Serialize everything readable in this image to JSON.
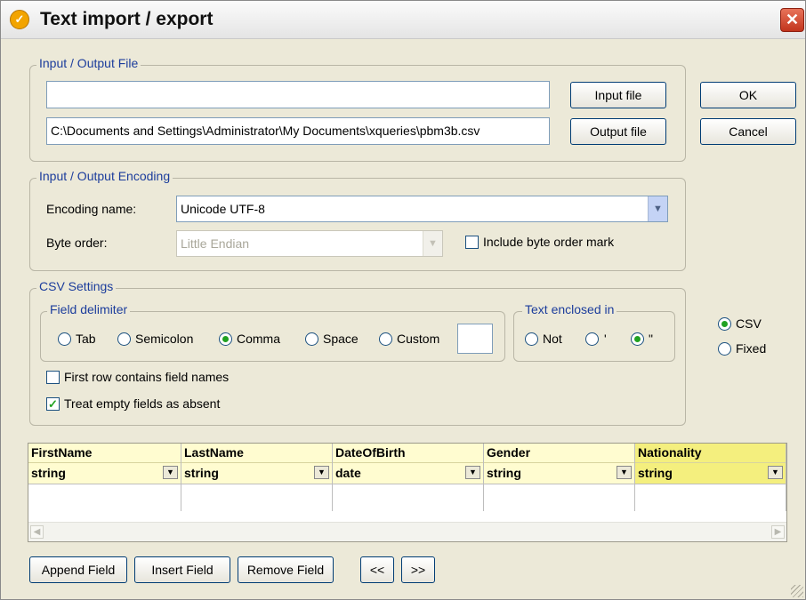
{
  "window": {
    "title": "Text import / export",
    "close_glyph": "✕"
  },
  "io_file": {
    "legend": "Input / Output File",
    "input_path": "",
    "output_path": "C:\\Documents and Settings\\Administrator\\My Documents\\xqueries\\pbm3b.csv",
    "input_button": "Input file",
    "output_button": "Output file"
  },
  "dialog_buttons": {
    "ok": "OK",
    "cancel": "Cancel"
  },
  "encoding": {
    "legend": "Input / Output Encoding",
    "name_label": "Encoding name:",
    "name_value": "Unicode UTF-8",
    "byte_order_label": "Byte order:",
    "byte_order_value": "Little Endian",
    "bom_label": "Include byte order mark",
    "bom_checked": false
  },
  "csv": {
    "legend": "CSV Settings",
    "field_delimiter": {
      "legend": "Field delimiter",
      "options": [
        "Tab",
        "Semicolon",
        "Comma",
        "Space",
        "Custom"
      ],
      "selected": "Comma",
      "custom_value": ""
    },
    "text_enclosed": {
      "legend": "Text enclosed in",
      "options": [
        "Not",
        "'",
        "\""
      ],
      "selected": "\""
    },
    "first_row_label": "First row contains field names",
    "first_row_checked": false,
    "empty_fields_label": "Treat empty fields as absent",
    "empty_fields_checked": true
  },
  "format": {
    "options": [
      "CSV",
      "Fixed"
    ],
    "selected": "CSV"
  },
  "fields": {
    "columns": [
      {
        "name": "FirstName",
        "type": "string"
      },
      {
        "name": "LastName",
        "type": "string"
      },
      {
        "name": "DateOfBirth",
        "type": "date"
      },
      {
        "name": "Gender",
        "type": "string"
      },
      {
        "name": "Nationality",
        "type": "string"
      }
    ]
  },
  "bottom_buttons": {
    "append": "Append Field",
    "insert": "Insert Field",
    "remove": "Remove Field",
    "prev": "<<",
    "next": ">>"
  },
  "colors": {
    "legend_text": "#1c3d9c",
    "dialog_bg": "#ece9d8",
    "radio_dot": "#21a121",
    "highlight_column": "#f4ef7e"
  }
}
